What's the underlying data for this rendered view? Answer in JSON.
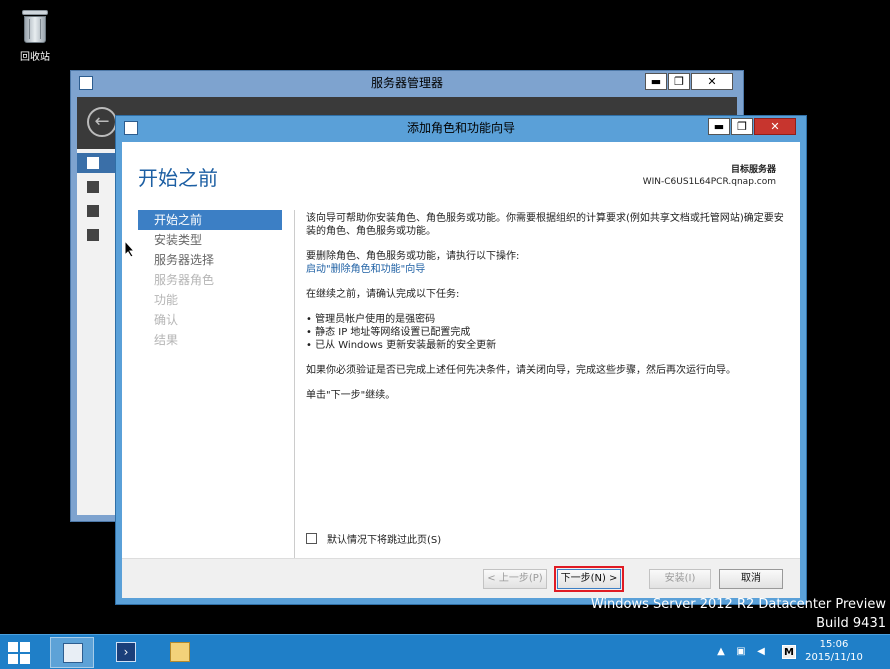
{
  "desktop": {
    "recycle_bin_label": "回收站"
  },
  "server_manager": {
    "title": "服务器管理器",
    "min": "▬",
    "max": "❐",
    "close": "✕"
  },
  "wizard": {
    "title": "添加角色和功能向导",
    "min": "▬",
    "max": "❐",
    "close": "✕",
    "heading": "开始之前",
    "target_label": "目标服务器",
    "target_value": "WIN-C6US1L64PCR.qnap.com",
    "steps": [
      "开始之前",
      "安装类型",
      "服务器选择",
      "服务器角色",
      "功能",
      "确认",
      "结果"
    ],
    "p1": "该向导可帮助你安装角色、角色服务或功能。你需要根据组织的计算要求(例如共享文档或托管网站)确定要安装的角色、角色服务或功能。",
    "p2": "要删除角色、角色服务或功能，请执行以下操作:",
    "p2_link": "启动\"删除角色和功能\"向导",
    "p3": "在继续之前，请确认完成以下任务:",
    "bullets": [
      "管理员帐户使用的是强密码",
      "静态 IP 地址等网络设置已配置完成",
      "已从 Windows 更新安装最新的安全更新"
    ],
    "p4": "如果你必须验证是否已完成上述任何先决条件，请关闭向导，完成这些步骤，然后再次运行向导。",
    "p5": "单击\"下一步\"继续。",
    "skip_label": "默认情况下将跳过此页(S)",
    "buttons": {
      "prev": "< 上一步(P)",
      "next": "下一步(N) >",
      "install": "安装(I)",
      "cancel": "取消"
    }
  },
  "watermark": {
    "line1": "Windows Server 2012 R2 Datacenter Preview",
    "line2": "Build 9431"
  },
  "taskbar": {
    "time": "15:06",
    "date": "2015/11/10",
    "tray_m": "M"
  },
  "colors": {
    "accent": "#3c7fc5",
    "taskbar": "#1f7fc8",
    "highlight": "#e01b24"
  }
}
